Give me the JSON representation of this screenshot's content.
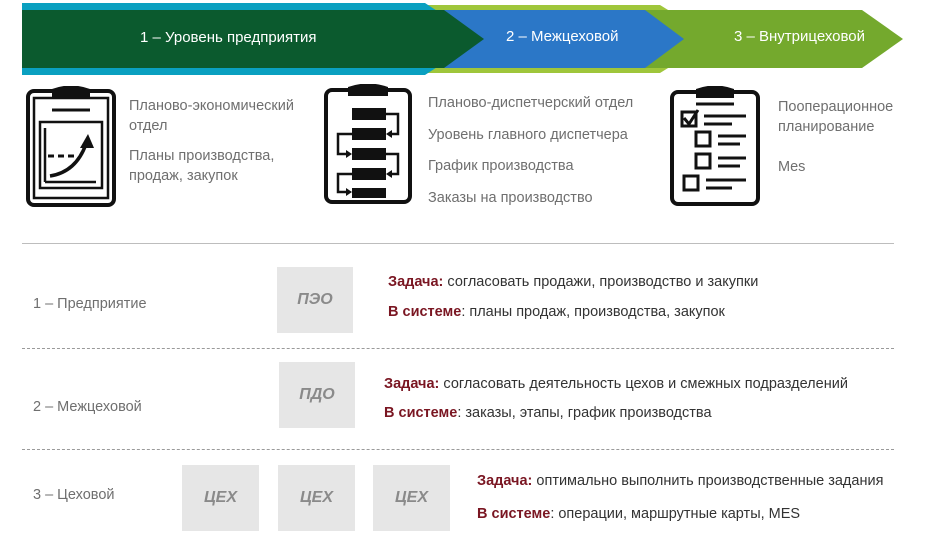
{
  "banner": {
    "stages": [
      {
        "label": "1 – Уровень предприятия"
      },
      {
        "label": "2 – Межцеховой"
      },
      {
        "label": "3 – Внутрицеховой"
      }
    ],
    "colors": {
      "dark_green": "#0b5a2e",
      "teal": "#0aa0c0",
      "blue": "#2b77c7",
      "green": "#74a92d",
      "lime": "#9fc63b"
    }
  },
  "icons": [
    {
      "name": "clipboard-chart-icon"
    },
    {
      "name": "clipboard-flow-icon"
    },
    {
      "name": "clipboard-checklist-icon"
    }
  ],
  "columns": [
    {
      "lines": [
        "Планово-экономический",
        "отдел",
        "Планы производства,",
        "продаж, закупок"
      ]
    },
    {
      "lines": [
        "Планово-диспетчерский отдел",
        "Уровень главного диспетчера",
        "График производства",
        "Заказы на производство"
      ]
    },
    {
      "lines": [
        "Пооперационное",
        "планирование",
        "Mes"
      ]
    }
  ],
  "levels": [
    {
      "label": "1 – Предприятие",
      "boxes": [
        "ПЭО"
      ],
      "task_key": "Задача:",
      "task_text": " согласовать продажи, производство и закупки",
      "system_key": "В системе",
      "system_text": ": планы продаж, производства, закупок"
    },
    {
      "label": "2 – Межцеховой",
      "boxes": [
        "ПДО"
      ],
      "task_key": "Задача:",
      "task_text": " согласовать деятельность цехов и смежных подразделений",
      "system_key": "В системе",
      "system_text": ":  заказы, этапы, график производства"
    },
    {
      "label": "3 – Цеховой",
      "boxes": [
        "ЦЕХ",
        "ЦЕХ",
        "ЦЕХ"
      ],
      "task_key": "Задача:",
      "task_text": " оптимально выполнить производственные задания",
      "system_key": "В системе",
      "system_text": ": операции, маршрутные карты, MES"
    }
  ]
}
